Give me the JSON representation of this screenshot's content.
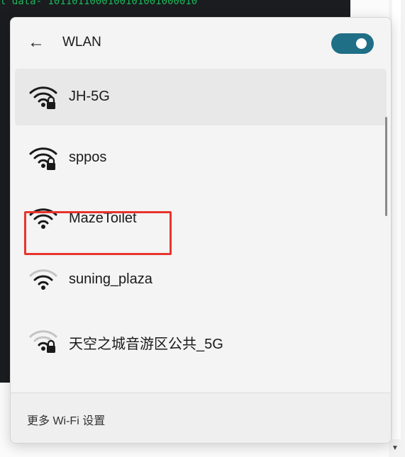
{
  "terminal": {
    "lines": [
      "l data- 1011011000100101001000010"
    ]
  },
  "panel": {
    "title": "WLAN",
    "toggle_on": true,
    "networks": [
      {
        "ssid": "JH-5G",
        "secured": true,
        "signal": "full",
        "selected": true
      },
      {
        "ssid": "sppos",
        "secured": true,
        "signal": "full",
        "selected": false
      },
      {
        "ssid": "MazeToilet",
        "secured": false,
        "signal": "full",
        "selected": false
      },
      {
        "ssid": "suning_plaza",
        "secured": false,
        "signal": "medium",
        "selected": false
      },
      {
        "ssid": "天空之城音游区公共_5G",
        "secured": true,
        "signal": "weak",
        "selected": false
      }
    ],
    "footer_link": "更多 Wi-Fi 设置"
  },
  "colors": {
    "accent": "#1f6f86",
    "highlight": "#e8342e",
    "terminal_text": "#1db85a"
  }
}
